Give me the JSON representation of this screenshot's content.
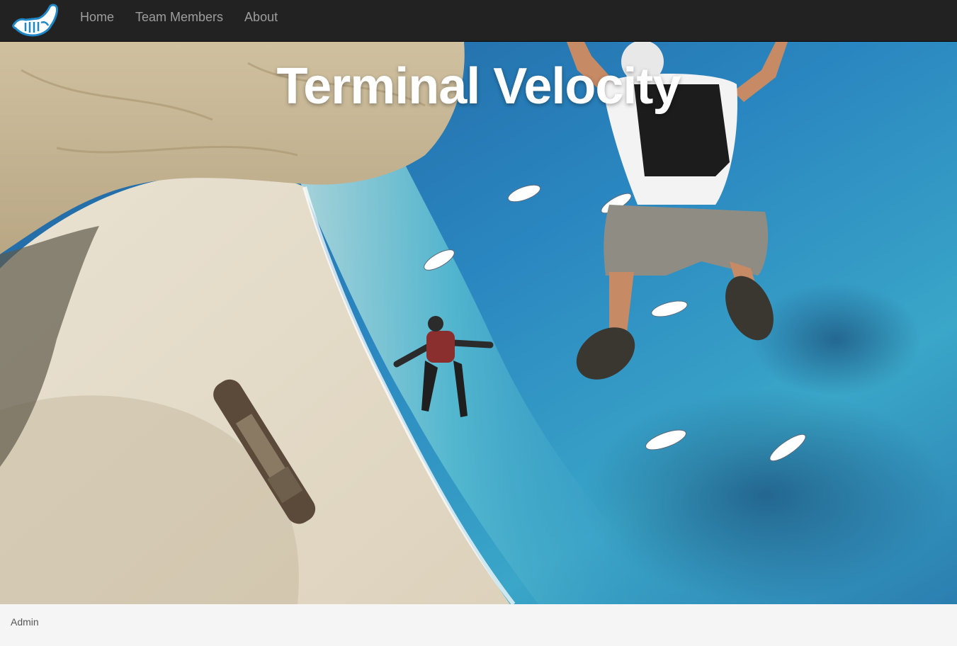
{
  "navbar": {
    "brand_icon": "shaka-hand-icon",
    "links": [
      {
        "label": "Home"
      },
      {
        "label": "Team Members"
      },
      {
        "label": "About"
      }
    ]
  },
  "hero": {
    "title": "Terminal Velocity",
    "image": "skydivers-over-shipwreck-beach"
  },
  "footer": {
    "admin_label": "Admin"
  },
  "colors": {
    "navbar_bg": "#222222",
    "nav_text": "#9d9d9d",
    "footer_bg": "#f5f5f5",
    "brand_blue": "#1e88c8"
  }
}
